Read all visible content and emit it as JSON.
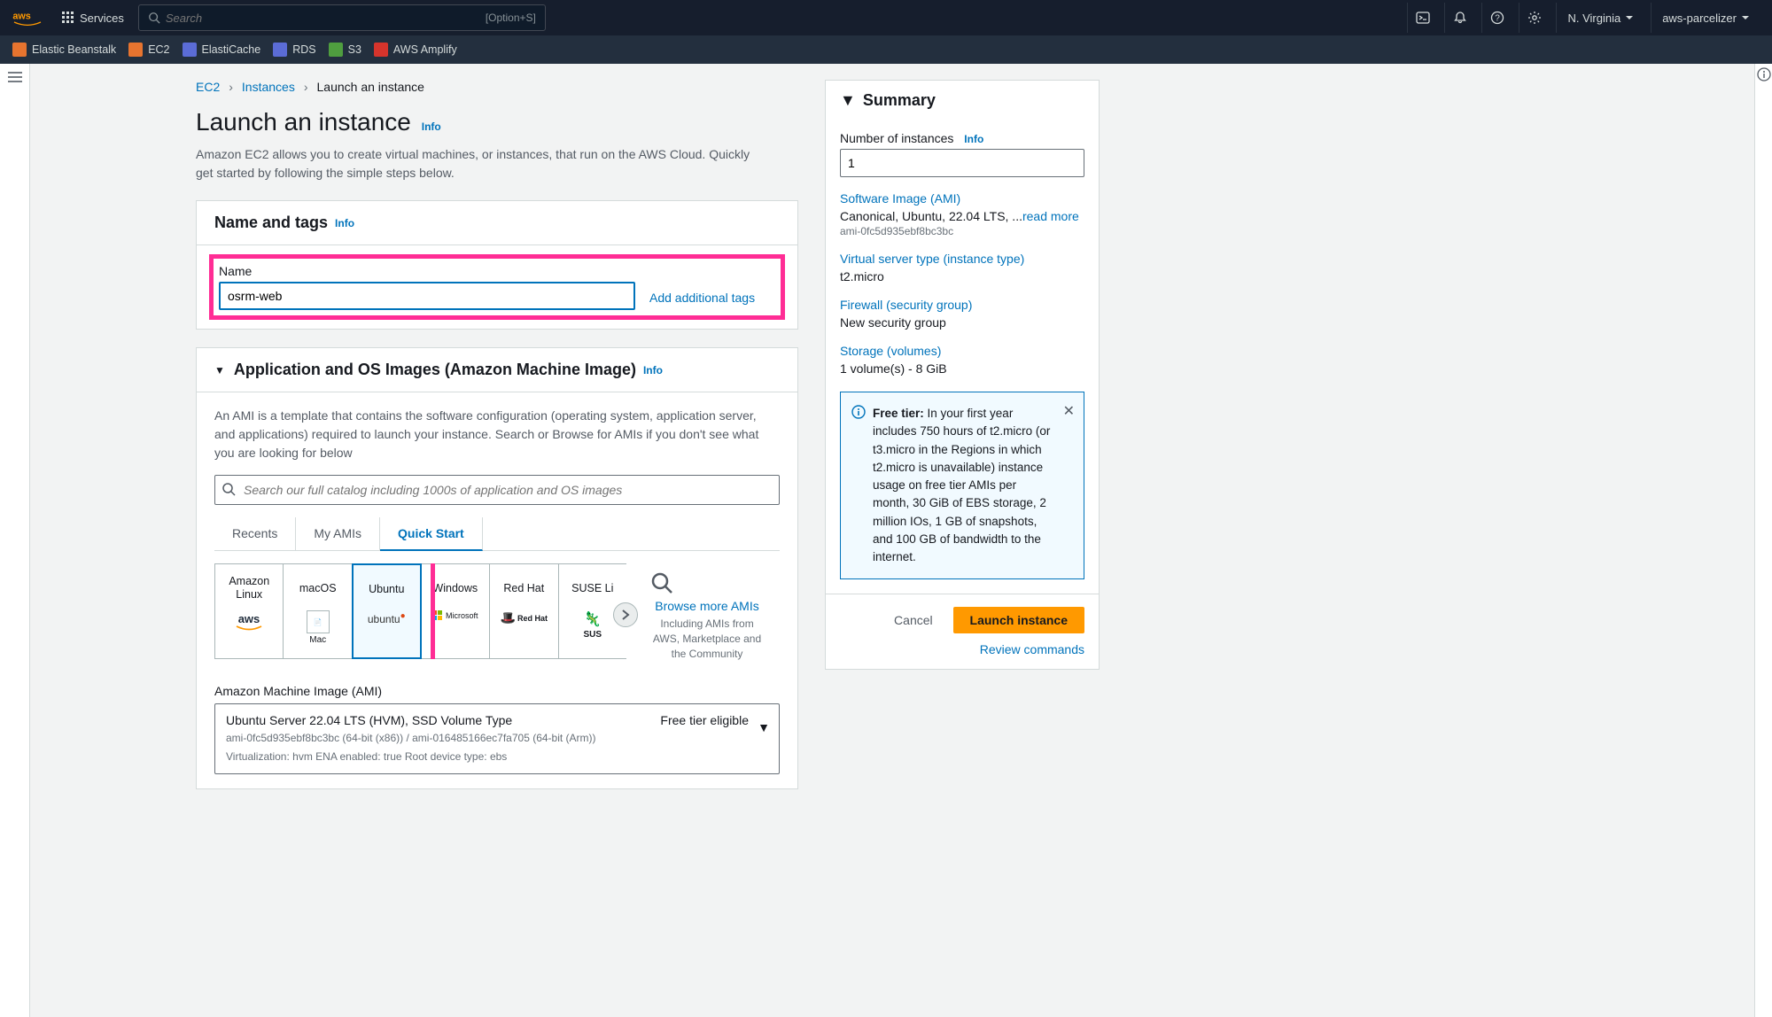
{
  "topnav": {
    "services": "Services",
    "search_placeholder": "Search",
    "search_shortcut": "[Option+S]",
    "region": "N. Virginia",
    "account": "aws-parcelizer"
  },
  "favorites": [
    {
      "label": "Elastic Beanstalk",
      "color": "#e7742f"
    },
    {
      "label": "EC2",
      "color": "#e7742f"
    },
    {
      "label": "ElastiCache",
      "color": "#5b6cd6"
    },
    {
      "label": "RDS",
      "color": "#5b6cd6"
    },
    {
      "label": "S3",
      "color": "#4f9e3f"
    },
    {
      "label": "AWS Amplify",
      "color": "#d6342c"
    }
  ],
  "breadcrumb": {
    "root": "EC2",
    "mid": "Instances",
    "current": "Launch an instance"
  },
  "heading": {
    "title": "Launch an instance",
    "info": "Info",
    "subtitle": "Amazon EC2 allows you to create virtual machines, or instances, that run on the AWS Cloud. Quickly get started by following the simple steps below."
  },
  "name_panel": {
    "title": "Name and tags",
    "info": "Info",
    "name_label": "Name",
    "name_value": "osrm-web",
    "add_tags": "Add additional tags"
  },
  "ami_panel": {
    "title": "Application and OS Images (Amazon Machine Image)",
    "info": "Info",
    "desc": "An AMI is a template that contains the software configuration (operating system, application server, and applications) required to launch your instance. Search or Browse for AMIs if you don't see what you are looking for below",
    "search_placeholder": "Search our full catalog including 1000s of application and OS images",
    "tabs": [
      "Recents",
      "My AMIs",
      "Quick Start"
    ],
    "active_tab": "Quick Start",
    "os_cards": [
      {
        "name": "Amazon Linux",
        "logo": "aws"
      },
      {
        "name": "macOS",
        "logo": "Mac"
      },
      {
        "name": "Ubuntu",
        "logo": "ubuntu"
      },
      {
        "name": "Windows",
        "logo": "Microsoft"
      },
      {
        "name": "Red Hat",
        "logo": "RedHat"
      },
      {
        "name": "SUSE Li",
        "logo": "SUS"
      }
    ],
    "selected_os": "Ubuntu",
    "browse_more": "Browse more AMIs",
    "browse_sub": "Including AMIs from AWS, Marketplace and the Community",
    "ami_field_label": "Amazon Machine Image (AMI)",
    "ami_selected_title": "Ubuntu Server 22.04 LTS (HVM), SSD Volume Type",
    "ami_selected_meta1": "ami-0fc5d935ebf8bc3bc (64-bit (x86)) / ami-016485166ec7fa705 (64-bit (Arm))",
    "ami_selected_meta2": "Virtualization: hvm    ENA enabled: true    Root device type: ebs",
    "free_tier": "Free tier eligible"
  },
  "summary": {
    "title": "Summary",
    "num_label": "Number of instances",
    "info": "Info",
    "num_value": "1",
    "ami_link": "Software Image (AMI)",
    "ami_val": "Canonical, Ubuntu, 22.04 LTS, ...",
    "read_more": "read more",
    "ami_id": "ami-0fc5d935ebf8bc3bc",
    "type_link": "Virtual server type (instance type)",
    "type_val": "t2.micro",
    "sg_link": "Firewall (security group)",
    "sg_val": "New security group",
    "storage_link": "Storage (volumes)",
    "storage_val": "1 volume(s) - 8 GiB",
    "alert_bold": "Free tier:",
    "alert_text": " In your first year includes 750 hours of t2.micro (or t3.micro in the Regions in which t2.micro is unavailable) instance usage on free tier AMIs per month, 30 GiB of EBS storage, 2 million IOs, 1 GB of snapshots, and 100 GB of bandwidth to the internet.",
    "cancel": "Cancel",
    "launch": "Launch instance",
    "review": "Review commands"
  }
}
